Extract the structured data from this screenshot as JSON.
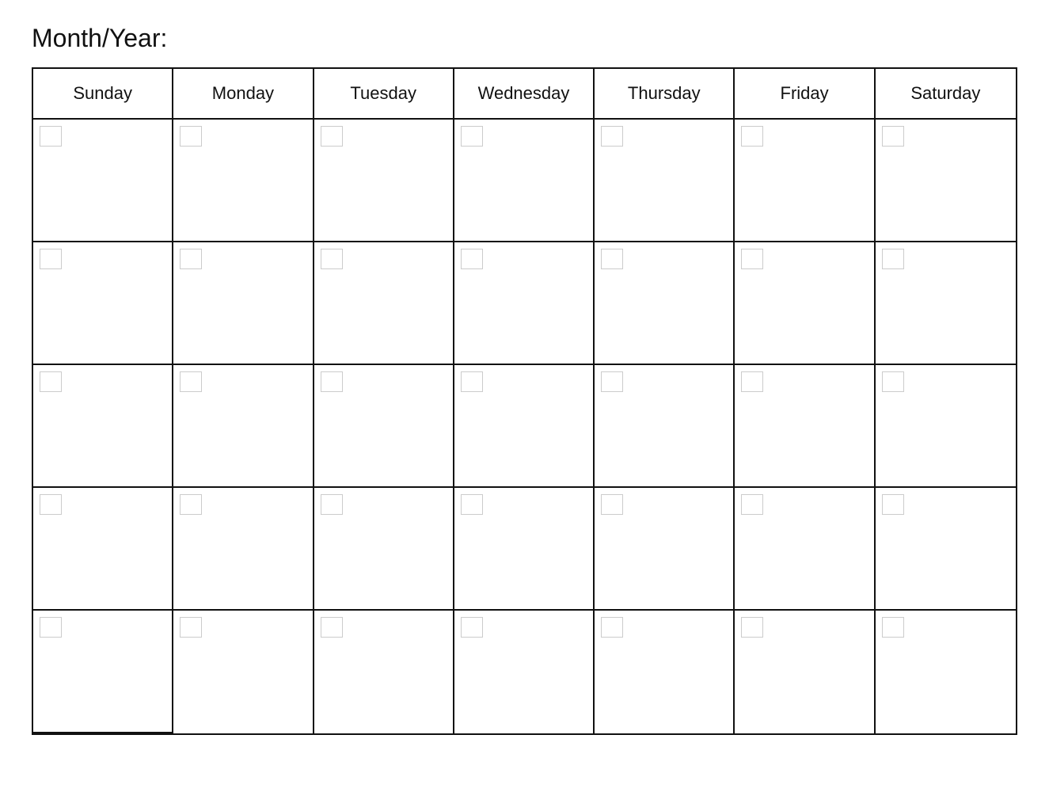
{
  "header": {
    "title": "Month/Year:"
  },
  "calendar": {
    "days": [
      "Sunday",
      "Monday",
      "Tuesday",
      "Wednesday",
      "Thursday",
      "Friday",
      "Saturday"
    ],
    "rows": 5,
    "cols": 7
  }
}
